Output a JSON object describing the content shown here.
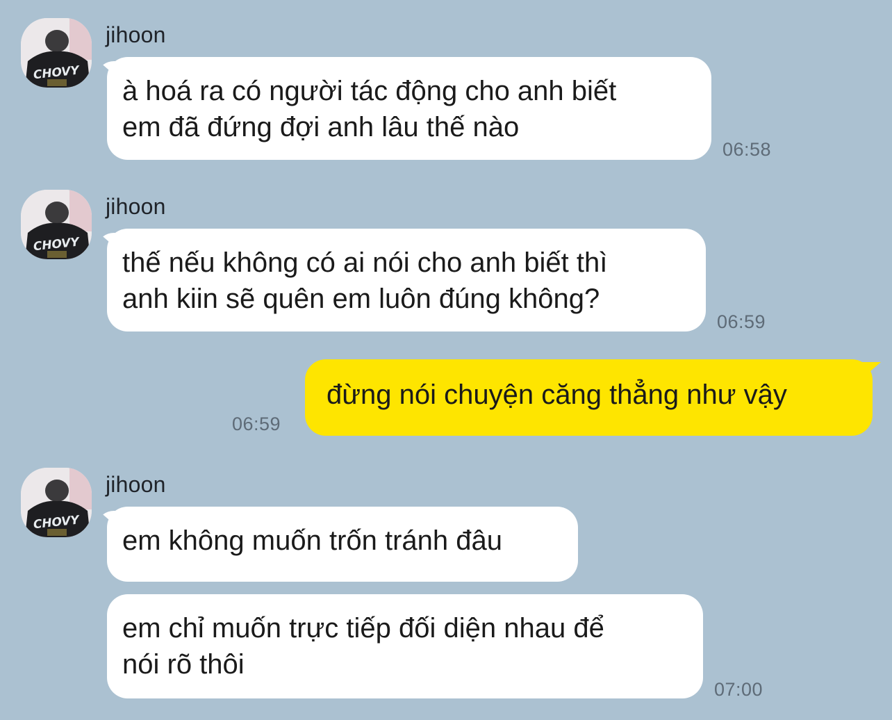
{
  "colors": {
    "background": "#abc1d1",
    "incoming_bubble": "#ffffff",
    "outgoing_bubble": "#fee500",
    "timestamp": "#5e6b77"
  },
  "groups": [
    {
      "sender": "jihoon",
      "avatar_icon": "avatar-photo-icon",
      "messages": [
        {
          "text": "à hoá ra có người tác động cho anh biết\nem đã đứng đợi anh lâu thế nào",
          "time": "06:58"
        }
      ]
    },
    {
      "sender": "jihoon",
      "avatar_icon": "avatar-photo-icon",
      "messages": [
        {
          "text": "thế nếu không có ai nói cho anh biết thì\nanh kiin sẽ quên em luôn đúng không?",
          "time": "06:59"
        }
      ]
    },
    {
      "sender": "me",
      "messages": [
        {
          "text": "đừng nói chuyện căng thẳng như vậy",
          "time": "06:59"
        }
      ]
    },
    {
      "sender": "jihoon",
      "avatar_icon": "avatar-photo-icon",
      "messages": [
        {
          "text": "em không muốn trốn tránh đâu",
          "time": ""
        },
        {
          "text": "em chỉ muốn trực tiếp đối diện nhau để\nnói rõ thôi",
          "time": "07:00"
        }
      ]
    }
  ]
}
